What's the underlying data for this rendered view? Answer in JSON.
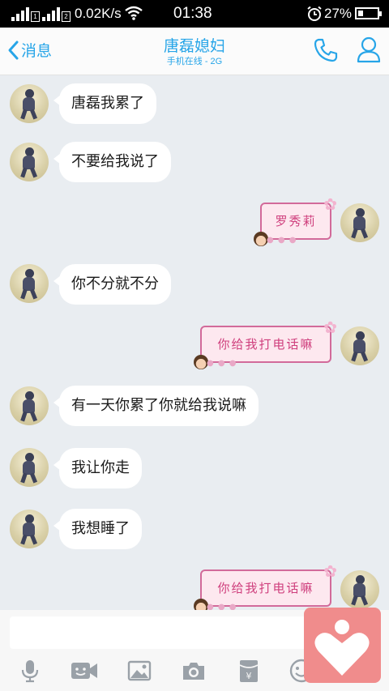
{
  "status_bar": {
    "sim1_label": "1",
    "sim2_label": "2",
    "net_speed": "0.02K/s",
    "time": "01:38",
    "battery_percent": "27%",
    "battery_level": 0.27
  },
  "header": {
    "back_label": "消息",
    "title": "唐磊媳妇",
    "subtitle": "手机在线 - 2G",
    "icons": [
      "phone-icon",
      "contact-profile-icon"
    ]
  },
  "messages": [
    {
      "side": "left",
      "type": "text",
      "text": "唐磊我累了"
    },
    {
      "side": "left",
      "type": "text",
      "text": "不要给我说了"
    },
    {
      "side": "right",
      "type": "sticker",
      "text": "罗秀莉"
    },
    {
      "side": "left",
      "type": "text",
      "text": "你不分就不分"
    },
    {
      "side": "right",
      "type": "sticker",
      "text": "你给我打电话嘛"
    },
    {
      "side": "left",
      "type": "text",
      "text": "有一天你累了你就给我说嘛"
    },
    {
      "side": "left",
      "type": "text",
      "text": "我让你走"
    },
    {
      "side": "left",
      "type": "text",
      "text": "我想睡了"
    },
    {
      "side": "right",
      "type": "sticker",
      "text": "你给我打电话嘛"
    }
  ],
  "input": {
    "value": "",
    "toolbar_icons": [
      "microphone-icon",
      "video-call-icon",
      "image-icon",
      "camera-icon",
      "red-packet-icon",
      "emoji-icon"
    ]
  },
  "colors": {
    "accent": "#27a5e8",
    "sticker_border": "#d26a9a",
    "sticker_text": "#cf3f7d",
    "sticker_bg": "#fde8ef",
    "chat_bg": "#e9edf1",
    "floating_button": "#f08c8c"
  }
}
